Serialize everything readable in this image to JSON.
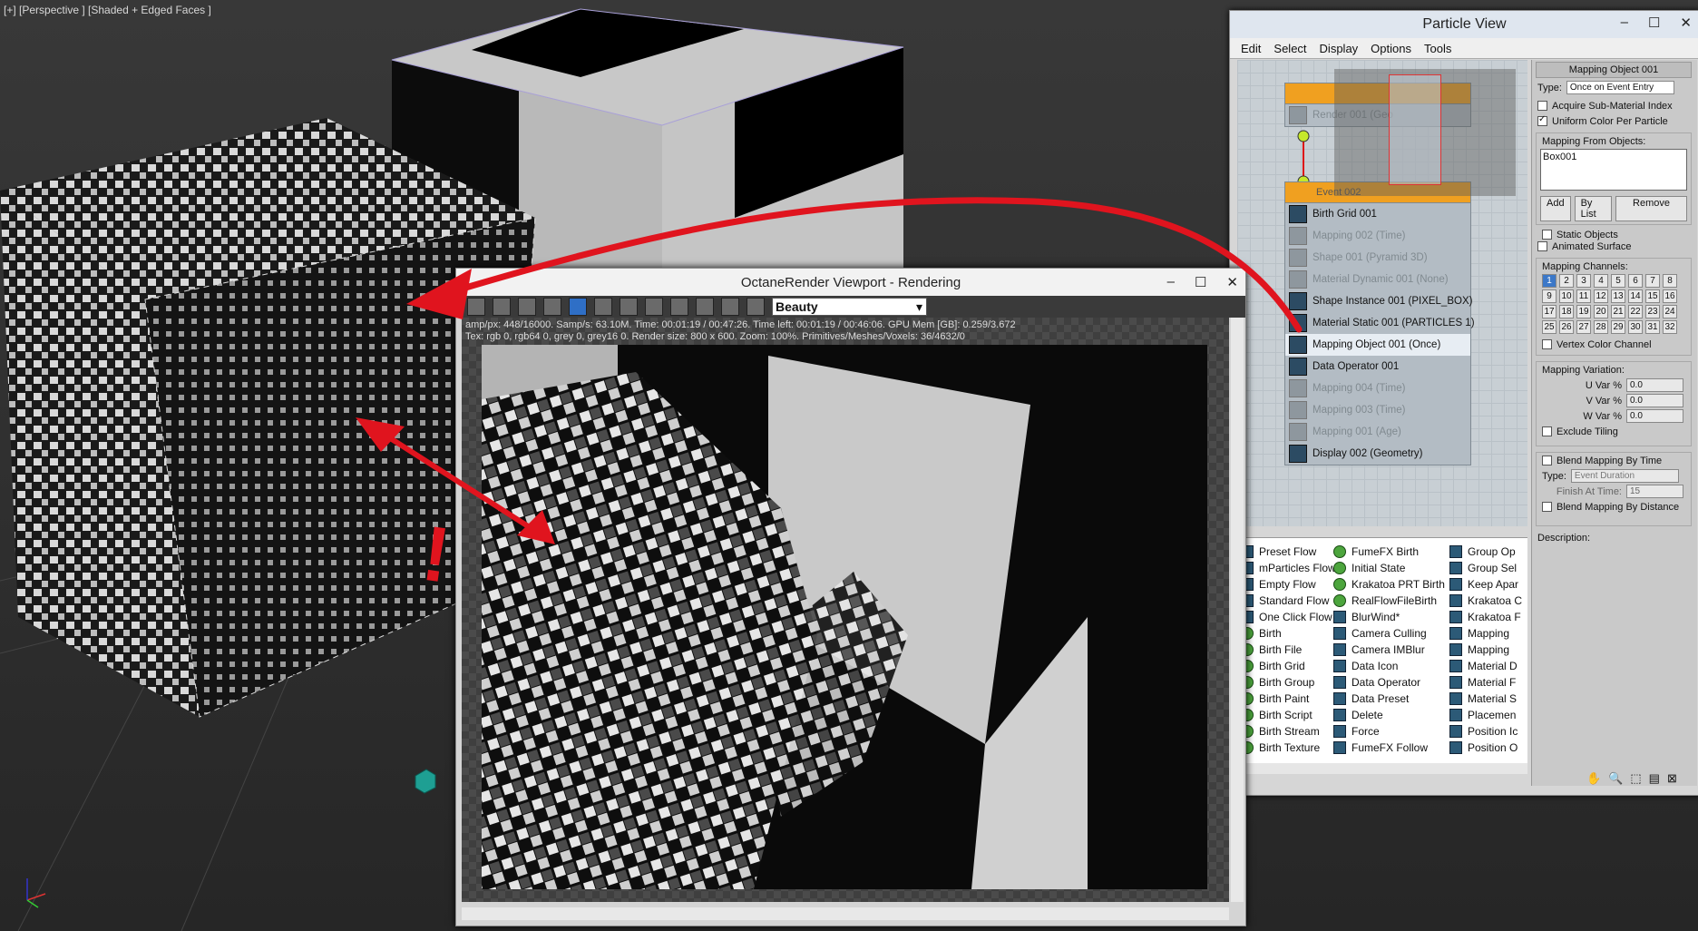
{
  "viewport": {
    "label": "[+] [Perspective ] [Shaded + Edged Faces ]"
  },
  "particle_view": {
    "title": "Particle View",
    "window_buttons": [
      "–",
      "☐",
      "✕"
    ],
    "menu": [
      "Edit",
      "Select",
      "Display",
      "Options",
      "Tools"
    ],
    "event1": {
      "operators": [
        {
          "label": "Render 001 (Geo",
          "state": "off"
        }
      ]
    },
    "event2": {
      "header": "Event 002",
      "operators": [
        {
          "label": "Birth Grid 001",
          "state": "on"
        },
        {
          "label": "Mapping 002 (Time)",
          "state": "off"
        },
        {
          "label": "Shape 001 (Pyramid 3D)",
          "state": "off"
        },
        {
          "label": "Material Dynamic 001 (None)",
          "state": "off"
        },
        {
          "label": "Shape Instance 001 (PIXEL_BOX)",
          "state": "on"
        },
        {
          "label": "Material Static 001 (PARTICLES 1)",
          "state": "on"
        },
        {
          "label": "Mapping Object 001 (Once)",
          "state": "sel"
        },
        {
          "label": "Data Operator 001",
          "state": "on"
        },
        {
          "label": "Mapping 004 (Time)",
          "state": "off"
        },
        {
          "label": "Mapping 003 (Time)",
          "state": "off"
        },
        {
          "label": "Mapping 001 (Age)",
          "state": "off"
        },
        {
          "label": "Display 002 (Geometry)",
          "state": "on"
        }
      ]
    },
    "depot": {
      "col1": [
        "Preset Flow",
        "mParticles Flow",
        "Empty Flow",
        "Standard Flow",
        "One Click Flow",
        "Birth",
        "Birth File",
        "Birth Grid",
        "Birth Group",
        "Birth Paint",
        "Birth Script",
        "Birth Stream",
        "Birth Texture"
      ],
      "col2": [
        "FumeFX Birth",
        "Initial State",
        "Krakatoa PRT Birth",
        "RealFlowFileBirth",
        "BlurWind*",
        "Camera Culling",
        "Camera IMBlur",
        "Data Icon",
        "Data Operator",
        "Data Preset",
        "Delete",
        "Force",
        "FumeFX Follow"
      ],
      "col3": [
        "Group Op",
        "Group Sel",
        "Keep Apar",
        "Krakatoa C",
        "Krakatoa F",
        "Mapping",
        "Mapping",
        "Material D",
        "Material F",
        "Material S",
        "Placemen",
        "Position Ic",
        "Position O"
      ]
    },
    "side": {
      "rollout_title": "Mapping Object 001",
      "type_label": "Type:",
      "type_value": "Once on Event Entry",
      "acquire": "Acquire Sub-Material Index",
      "uniform": "Uniform Color Per Particle",
      "from_objects_label": "Mapping From Objects:",
      "object_list": [
        "Box001"
      ],
      "add": "Add",
      "by_list": "By List",
      "remove": "Remove",
      "static_objects": "Static Objects",
      "animated_surface": "Animated Surface",
      "channels_label": "Mapping Channels:",
      "channels": [
        "1",
        "2",
        "3",
        "4",
        "5",
        "6",
        "7",
        "8",
        "9",
        "10",
        "11",
        "12",
        "13",
        "14",
        "15",
        "16",
        "17",
        "18",
        "19",
        "20",
        "21",
        "22",
        "23",
        "24",
        "25",
        "26",
        "27",
        "28",
        "29",
        "30",
        "31",
        "32"
      ],
      "vertex_color": "Vertex Color Channel",
      "variation_label": "Mapping Variation:",
      "u_var": "U Var %",
      "v_var": "V Var %",
      "w_var": "W Var %",
      "u_val": "0.0",
      "v_val": "0.0",
      "w_val": "0.0",
      "exclude_tiling": "Exclude Tiling",
      "blend_time": "Blend Mapping By Time",
      "type2_label": "Type:",
      "type2_value": "Event Duration",
      "finish_label": "Finish At Time:",
      "finish_value": "15",
      "blend_distance": "Blend Mapping By Distance",
      "description_label": "Description:"
    }
  },
  "octane": {
    "title": "OctaneRender Viewport - Rendering",
    "window_buttons": [
      "–",
      "☐",
      "✕"
    ],
    "pass_select": "Beauty",
    "stats_line1": "amp/px: 448/16000.   Samp/s: 63.10M.   Time: 00:01:19 / 00:47:26.   Time left: 00:01:19 / 00:46:06.   GPU Mem [GB]: 0.259/3.672",
    "stats_line2": "Tex: rgb 0, rgb64 0, grey 0, grey16 0.   Render size: 800 x 600.   Zoom: 100%.   Primitives/Meshes/Voxels: 36/4632/0"
  },
  "annotation": {
    "mark": "!",
    "color": "#e0141e"
  }
}
